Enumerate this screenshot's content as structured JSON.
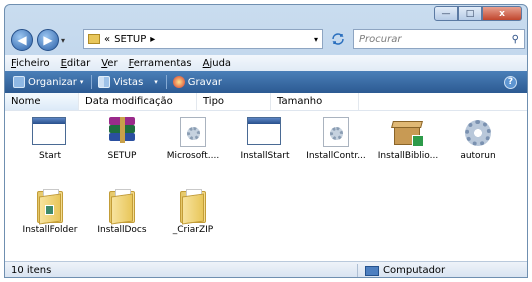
{
  "window": {
    "caption": {
      "minimize": "—",
      "maximize": "□",
      "close": "x"
    }
  },
  "navigation": {
    "back": "◀",
    "forward": "▶",
    "dropdown": "▾",
    "address": {
      "prefix": "«",
      "folder": "SETUP",
      "chevron": "▸",
      "dropdown": "▾"
    },
    "refresh_icon": "refresh-icon",
    "search_placeholder": "Procurar",
    "search_icon": "⚲"
  },
  "menu": [
    "Ficheiro",
    "Editar",
    "Ver",
    "Ferramentas",
    "Ajuda"
  ],
  "toolbar": {
    "organize": "Organizar",
    "views": "Vistas",
    "burn": "Gravar",
    "arrow": "▾",
    "help": "?"
  },
  "columns": [
    "Nome",
    "Data modificação",
    "Tipo",
    "Tamanho"
  ],
  "items": [
    {
      "label": "Start",
      "icon": "application-window-icon"
    },
    {
      "label": "SETUP",
      "icon": "winrar-archive-icon"
    },
    {
      "label": "Microsoft....",
      "icon": "settings-file-icon"
    },
    {
      "label": "InstallStart",
      "icon": "application-window-icon"
    },
    {
      "label": "InstallContr...",
      "icon": "settings-file-icon"
    },
    {
      "label": "InstallBiblio...",
      "icon": "installer-box-icon"
    },
    {
      "label": "autorun",
      "icon": "gear-settings-icon"
    },
    {
      "label": "InstallFolder",
      "icon": "folder-icon"
    },
    {
      "label": "InstallDocs",
      "icon": "folder-icon"
    },
    {
      "label": "_CriarZIP",
      "icon": "folder-icon"
    }
  ],
  "status": {
    "count": "10 itens",
    "location": "Computador"
  },
  "colors": {
    "toolbar": "#2c5a92",
    "titlebar": "#a9c6e4"
  }
}
